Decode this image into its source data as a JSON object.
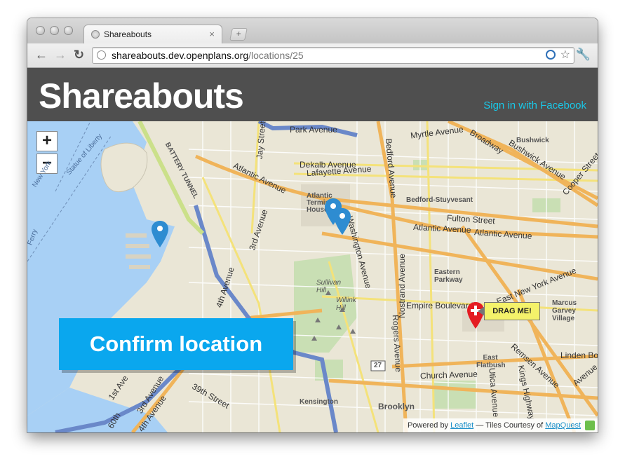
{
  "browser": {
    "tab_title": "Shareabouts",
    "tab_close": "×",
    "newtab": "+",
    "url_host": "shareabouts.dev.openplans.org",
    "url_path": "/locations/25",
    "nav": {
      "back": "←",
      "forward": "→",
      "reload": "↻"
    },
    "star": "☆",
    "wrench": "🔧"
  },
  "header": {
    "title": "Shareabouts",
    "signin": "Sign in with Facebook"
  },
  "map": {
    "zoom_in": "+",
    "zoom_out": "−",
    "labels": {
      "park_avenue": "Park Avenue",
      "myrtle_avenue": "Myrtle Avenue",
      "bushwick": "Bushwick",
      "broadway": "Broadway",
      "bushwick_avenue": "Bushwick Avenue",
      "cooper_street": "Cooper Street",
      "jay_street": "Jay Street",
      "bedford_avenue": "Bedford Avenue",
      "dekalb_avenue": "Dekalb Avenue",
      "lafayette_avenue": "Lafayette Avenue",
      "battery_tunnel": "BATTERY TUNNEL",
      "statue_of_liberty": "Statue of Liberty",
      "new_york": "New York",
      "atlantic_avenue_left": "Atlantic Avenue",
      "atlantic_terminal": "Atlantic Terminal Houses",
      "bedford_stuyvesant": "Bedford-Stuyvesant",
      "fulton_street": "Fulton Street",
      "atlantic_avenue_right": "Atlantic Avenue",
      "atlantic_avenue_right2": "Atlantic Avenue",
      "third_avenue": "3rd Avenue",
      "fourth_avenue": "4th Avenue",
      "washington_avenue": "Washington Avenue",
      "ferry": "Ferry",
      "eastern_parkway": "Eastern Parkway",
      "east_new_york": "East New York Avenue",
      "sullivan_hill": "Sullivan Hill",
      "willink_hill": "Willink Hill",
      "nostrand_avenue": "Nostrand Avenue",
      "empire_boulevard": "Empire Boulevard",
      "marcus_garvey": "Marcus Garvey Village",
      "rogers_avenue": "Rogers Avenue",
      "remsen_avenue": "Remsen Avenue",
      "linden_boulevard": "Linden Bo",
      "route_27": "27",
      "east_flatbush": "East Flatbush",
      "church_avenue": "Church Avenue",
      "kings_highway": "Kings Highway",
      "avenue_right": "Avenue",
      "utica_avenue": "Utica Avenue",
      "first_avenue": "1st Ave",
      "third_avenue_sw": "3rd Avenue",
      "fourth_avenue_sw": "4th Avenue",
      "thirtyninth_street": "39th Street",
      "sixtieth": "60th",
      "kensington": "Kensington",
      "brooklyn": "Brooklyn"
    },
    "drag_tip": "DRAG ME!",
    "confirm_button": "Confirm location",
    "attribution": {
      "powered_by": "Powered by ",
      "leaflet": "Leaflet",
      "tiles": " — Tiles Courtesy of ",
      "mapquest": "MapQuest"
    },
    "colors": {
      "water": "#a8d0f5",
      "land": "#eae6d6",
      "park": "#c9dfb4",
      "highway": "#6a88c9",
      "major_road": "#f0b45a",
      "marker_blue": "#2e8cd1",
      "marker_red": "#e41c22",
      "button": "#0aa7ee"
    }
  }
}
